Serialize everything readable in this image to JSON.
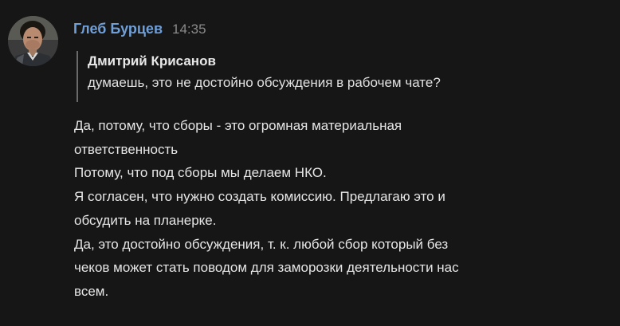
{
  "message": {
    "author": "Глеб Бурцев",
    "time": "14:35",
    "avatar_icon": "user-avatar-photo",
    "reply": {
      "author": "Дмитрий Крисанов",
      "text": "думаешь, это не достойно обсуждения в рабочем чате?"
    },
    "lines": [
      "Да, потому, что сборы - это огромная материальная",
      "ответственность",
      "Потому, что под сборы мы делаем НКО.",
      "Я согласен, что нужно создать комиссию. Предлагаю это и",
      "обсудить на планерке.",
      "Да, это достойно обсуждения, т. к. любой сбор который без",
      "чеков может стать поводом для заморозки деятельности нас",
      "всем."
    ]
  },
  "colors": {
    "background": "#161616",
    "author": "#6f9fd8",
    "time": "#8a8a8a",
    "text": "#e6e6e6",
    "reply_bar": "#6a6a6a"
  }
}
